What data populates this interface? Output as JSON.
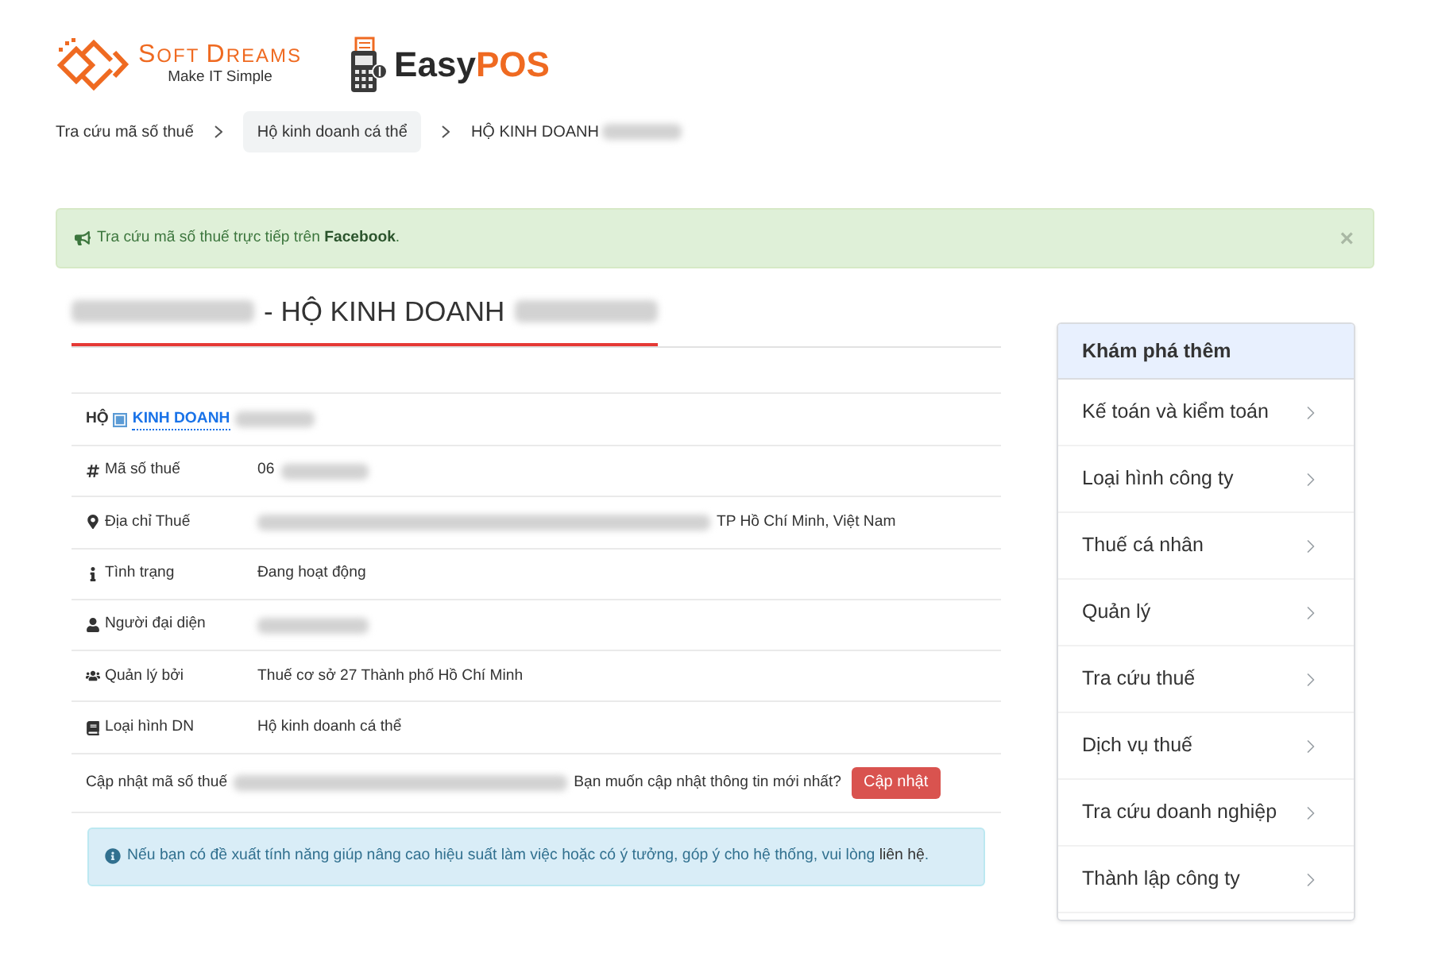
{
  "brand": {
    "name": "SOFT DREAMS",
    "tagline": "Make IT Simple"
  },
  "product_logo": {
    "name_parts": [
      "Easy",
      "POS"
    ]
  },
  "breadcrumb": [
    {
      "label": "Tra cứu mã số thuế",
      "highlighted": false,
      "redacted_suffix": false
    },
    {
      "label": "Hộ kinh doanh cá thể",
      "highlighted": true,
      "redacted_suffix": false
    },
    {
      "label": "HỘ KINH DOANH",
      "highlighted": false,
      "redacted_suffix": true
    }
  ],
  "alert": {
    "text": "Tra cứu mã số thuế trực tiếp trên **Facebook**.",
    "close": "×"
  },
  "title": [
    {
      "kind": "redacted"
    },
    {
      "kind": "text",
      "text": "- HỘ KINH DOANH"
    },
    {
      "kind": "redacted"
    }
  ],
  "heading_row": {
    "prefix": "HỘ",
    "link": "KINH DOANH",
    "redacted_suffix": true
  },
  "rows": [
    {
      "label": "Mã số thuế",
      "value": [
        {
          "kind": "text",
          "text": "06"
        },
        {
          "kind": "redacted"
        }
      ]
    },
    {
      "label": "Địa chỉ Thuế",
      "value": [
        {
          "kind": "redacted"
        },
        {
          "kind": "text",
          "text": "TP Hồ Chí Minh, Việt Nam"
        }
      ]
    },
    {
      "label": "Tình trạng",
      "value": [
        {
          "kind": "text",
          "text": "Đang hoạt động"
        }
      ]
    },
    {
      "label": "Người đại diện",
      "value": [
        {
          "kind": "redacted"
        }
      ]
    },
    {
      "label": "Quản lý bởi",
      "value": [
        {
          "kind": "text",
          "text": "Thuế cơ sở 27 Thành phố Hồ Chí Minh"
        }
      ]
    },
    {
      "label": "Loại hình DN",
      "value": [
        {
          "kind": "text",
          "text": "Hộ kinh doanh cá thể"
        }
      ]
    }
  ],
  "update_row": {
    "parts": [
      {
        "kind": "text",
        "text": "Cập nhật mã số thuế"
      },
      {
        "kind": "redacted"
      },
      {
        "kind": "text",
        "text": "Bạn muốn cập nhật thông tin mới nhất?"
      }
    ],
    "button": "Cập nhật"
  },
  "notice": {
    "text": "Nếu bạn có đề xuất tính năng giúp nâng cao hiệu suất làm việc hoặc có ý tưởng, góp ý cho hệ thống, vui lòng",
    "link": "liên hệ",
    "end": "."
  },
  "sidebar": {
    "title": "Khám phá thêm",
    "items": [
      "Kế toán và kiểm toán",
      "Loại hình công ty",
      "Thuế cá nhân",
      "Quản lý",
      "Tra cứu thuế",
      "Dịch vụ thuế",
      "Tra cứu doanh nghiệp",
      "Thành lập công ty"
    ]
  }
}
